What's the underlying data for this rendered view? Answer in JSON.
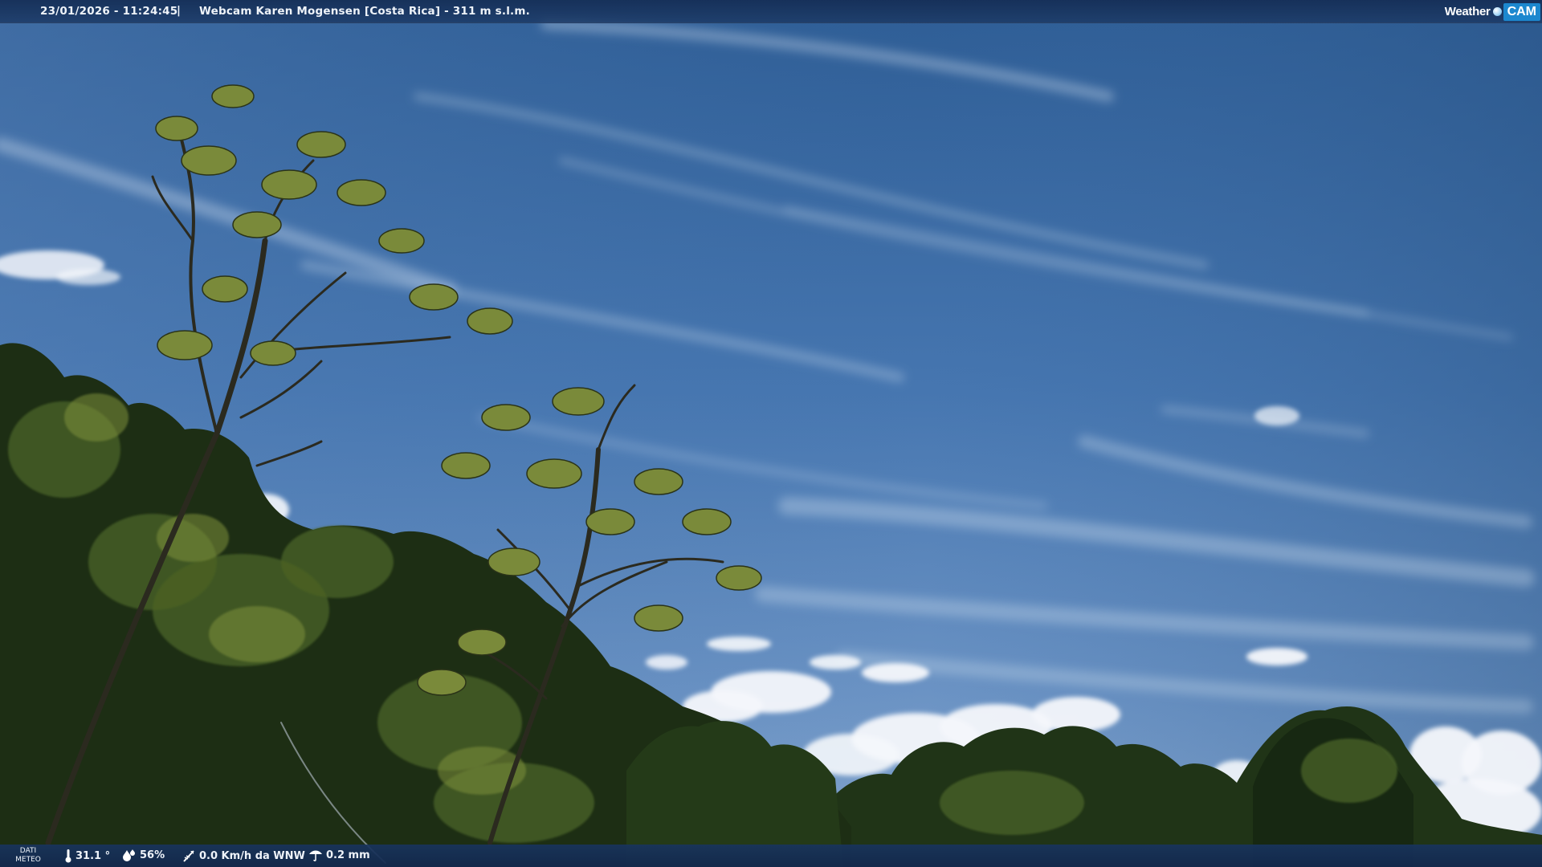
{
  "top_bar": {
    "datetime": "23/01/2026 - 11:24:45",
    "separator": "|",
    "camera_title": "Webcam Karen Mogensen [Costa Rica] - 311 m s.l.m."
  },
  "logo": {
    "word": "Weather",
    "badge": "CAM"
  },
  "bottom_bar": {
    "data_label_line1": "DATI",
    "data_label_line2": "METEO",
    "temperature": "31.1 °",
    "temperature_icon": "thermometer-icon",
    "humidity": "56%",
    "humidity_icon": "humidity-drop-icon",
    "wind": "0.0 Km/h da WNW",
    "wind_icon": "wind-vane-icon",
    "rain": "0.2 mm",
    "rain_icon": "rain-gauge-icon"
  },
  "colors": {
    "sky_top": "#2e5d95",
    "sky_bottom": "#86a7cf",
    "foliage_dark": "#1d2e14",
    "foliage_light": "#7d8f3a",
    "bar_background": "#1c3a66",
    "logo_badge": "#1c88cf"
  }
}
